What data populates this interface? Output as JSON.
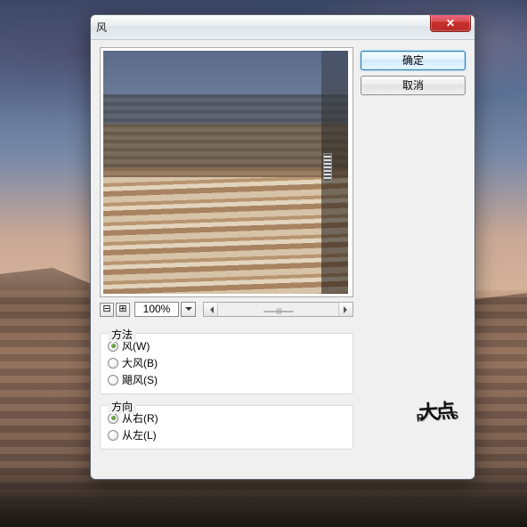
{
  "dialog": {
    "title": "风",
    "buttons": {
      "ok": "确定",
      "cancel": "取消"
    },
    "zoom": {
      "minus": "⊟",
      "plus": "⊞",
      "value": "100%"
    },
    "method": {
      "title": "方法",
      "options": [
        {
          "label": "风(W)",
          "selected": true
        },
        {
          "label": "大风(B)",
          "selected": false
        },
        {
          "label": "飓风(S)",
          "selected": false
        }
      ]
    },
    "direction": {
      "title": "方向",
      "options": [
        {
          "label": "从右(R)",
          "selected": true
        },
        {
          "label": "从左(L)",
          "selected": false
        }
      ]
    }
  },
  "watermark": {
    "left": "P",
    "mid": "大点",
    "right": "S"
  }
}
